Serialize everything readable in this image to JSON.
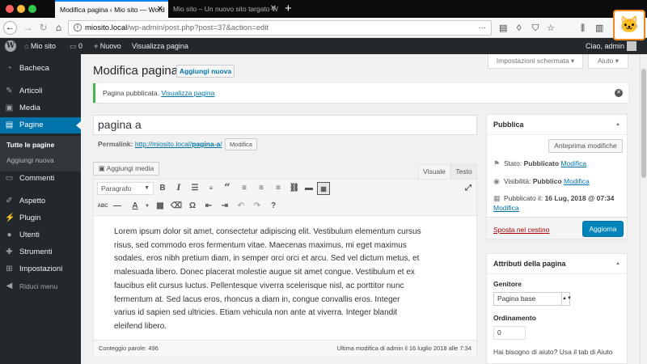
{
  "browser": {
    "tabs": [
      {
        "title": "Modifica pagina ‹ Mio sito — Word"
      },
      {
        "title": "Mio sito – Un nuovo sito targato W"
      }
    ],
    "new_tab": "+",
    "url_host": "miosito.local",
    "url_path": "/wp-admin/post.php?post=37&action=edit"
  },
  "adminbar": {
    "site_name": "Mio sito",
    "comments_count": "0",
    "new_label": "Nuovo",
    "view_page": "Visualizza pagina",
    "greeting": "Ciao, admin"
  },
  "sidebar": {
    "items": [
      {
        "label": "Bacheca",
        "icon": "dashboard-icon"
      },
      {
        "label": "Articoli",
        "icon": "pin-icon"
      },
      {
        "label": "Media",
        "icon": "media-icon"
      },
      {
        "label": "Pagine",
        "icon": "pages-icon"
      },
      {
        "label": "Commenti",
        "icon": "comments-icon"
      },
      {
        "label": "Aspetto",
        "icon": "brush-icon"
      },
      {
        "label": "Plugin",
        "icon": "plugin-icon"
      },
      {
        "label": "Utenti",
        "icon": "users-icon"
      },
      {
        "label": "Strumenti",
        "icon": "tools-icon"
      },
      {
        "label": "Impostazioni",
        "icon": "settings-icon"
      },
      {
        "label": "Riduci menu",
        "icon": "collapse-icon"
      }
    ],
    "submenu": [
      "Tutte le pagine",
      "Aggiungi nuova"
    ]
  },
  "main": {
    "title": "Modifica pagina",
    "add_new": "Aggiungi nuova",
    "screen_options": "Impostazioni schermata",
    "help": "Aiuto",
    "notice_text": "Pagina pubblicata.",
    "notice_link": "Visualizza pagina",
    "post_title": "pagina a",
    "permalink_label": "Permalink:",
    "permalink_base": "http://miosito.local/",
    "permalink_slug": "pagina-a",
    "permalink_end": "/",
    "permalink_edit": "Modifica",
    "add_media": "Aggiungi media",
    "tab_visual": "Visuale",
    "tab_text": "Testo",
    "format_select": "Paragrafo",
    "content": "Lorem ipsum dolor sit amet, consectetur adipiscing elit. Vestibulum elementum cursus risus, sed commodo eros fermentum vitae. Maecenas maximus, mi eget maximus sodales, eros nibh pretium diam, in semper orci orci et arcu. Sed vel dictum metus, et malesuada libero. Donec placerat molestie augue sit amet congue. Vestibulum et ex faucibus elit cursus luctus. Pellentesque viverra scelerisque nisl, ac porttitor nunc fermentum at. Sed lacus eros, rhoncus a diam in, congue convallis eros. Integer varius id sapien sed ultricies. Etiam vehicula non ante at viverra. Integer blandit eleifend libero.",
    "word_count": "Conteggio parole: 496",
    "last_modified": "Ultima modifica di admin il 16 luglio 2018 alle 7:34"
  },
  "publish": {
    "title": "Pubblica",
    "preview": "Anteprima modifiche",
    "status_label": "Stato:",
    "status_value": "Pubblicato",
    "visibility_label": "Visibilità:",
    "visibility_value": "Pubblico",
    "published_label": "Pubblicato il:",
    "published_value": "16 Lug, 2018 @ 07:34",
    "edit": "Modifica",
    "trash": "Sposta nel cestino",
    "update": "Aggiorna"
  },
  "attributes": {
    "title": "Attributi della pagina",
    "parent_label": "Genitore",
    "parent_value": "Pagina base",
    "order_label": "Ordinamento",
    "order_value": "0",
    "help_text": "Hai bisogno di aiuto? Usa il tab di Aiuto"
  },
  "colors": {
    "accent": "#0073aa",
    "sidebar": "#23282d",
    "notice_success": "#46b450",
    "trash": "#a00000"
  }
}
